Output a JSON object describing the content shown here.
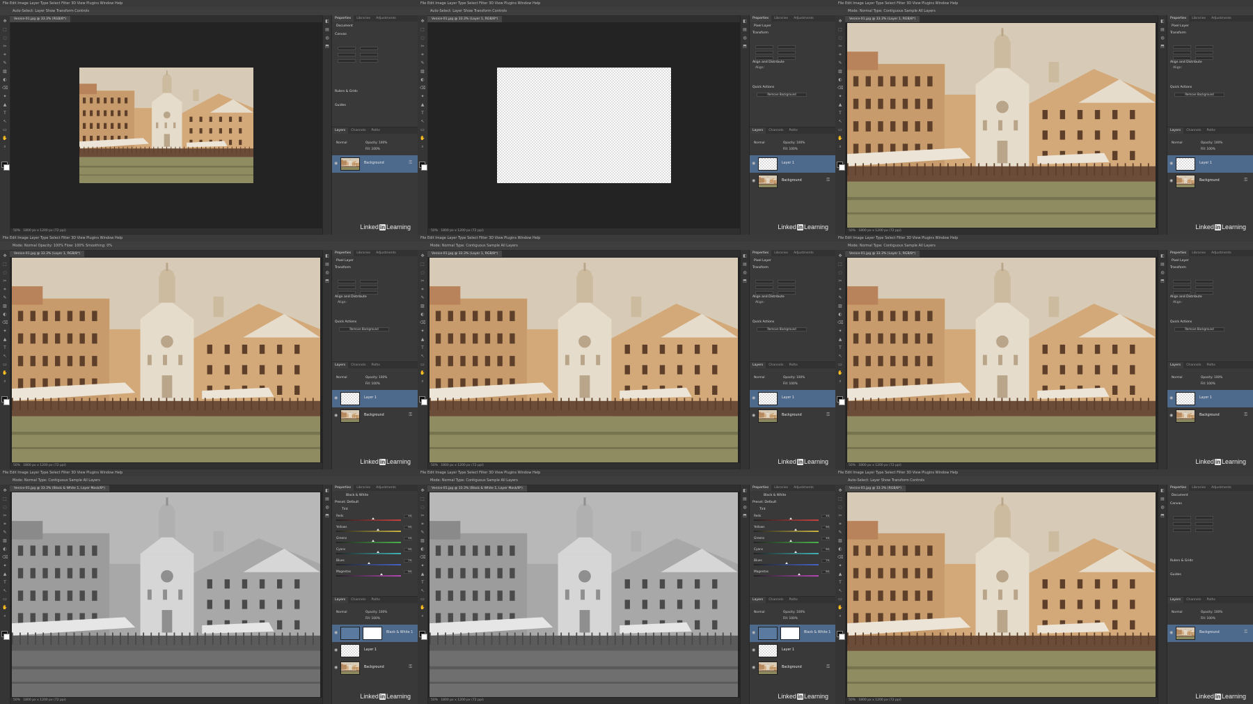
{
  "menu": "File  Edit  Image  Layer  Type  Select  Filter  3D  View  Plugins  Window  Help",
  "options": {
    "move": "Auto-Select:   Layer     Show Transform Controls",
    "brush": "Mode:  Normal    Opacity: 100%    Flow: 100%    Smoothing: 0%",
    "select": "Mode:  Normal    Type: Contiguous    Sample All Layers"
  },
  "app": {
    "watermark_pre": "Linked",
    "watermark_in": "in",
    "watermark_post": "Learning",
    "status_zoom": "50%",
    "status_size": "1800 px x 1200 px (72 ppi)"
  },
  "tabs": {
    "doc": "Venice-01.jpg @ 33.3% (RGB/8*)",
    "layer1": "Venice-01.jpg @ 33.3% (Layer 1, RGB/8*)",
    "bw": "Venice-01.jpg @ 33.3% (Black & White 1, Layer Mask/8*)"
  },
  "panel_tabs": {
    "properties": "Properties",
    "libraries": "Libraries",
    "adjustments": "Adjustments",
    "layers": "Layers",
    "channels": "Channels",
    "paths": "Paths"
  },
  "props": {
    "document": "Document",
    "pixel_layer": "Pixel Layer",
    "canvas": "Canvas",
    "transform": "Transform",
    "align": "Align and Distribute",
    "align_sub": "Align:",
    "quick": "Quick Actions",
    "remove_bg": "Remove Background",
    "rulers": "Rulers & Grids",
    "guides": "Guides",
    "bw_title": "Black & White",
    "preset": "Preset:  Default",
    "tint": "Tint"
  },
  "bw_sliders": [
    {
      "label": "Reds",
      "value": 40,
      "color": "#c94040",
      "pos": 0.55
    },
    {
      "label": "Yellows",
      "value": 60,
      "color": "#c9b440",
      "pos": 0.62
    },
    {
      "label": "Greens",
      "value": 40,
      "color": "#49b44a",
      "pos": 0.55
    },
    {
      "label": "Cyans",
      "value": 60,
      "color": "#3fb3b6",
      "pos": 0.62
    },
    {
      "label": "Blues",
      "value": 20,
      "color": "#4663c9",
      "pos": 0.48
    },
    {
      "label": "Magentas",
      "value": 80,
      "color": "#b546b3",
      "pos": 0.68
    }
  ],
  "layers": {
    "background": "Background",
    "layer1": "Layer 1",
    "bw": "Black & White 1",
    "blend": "Normal",
    "opacity": "Opacity: 100%",
    "fill": "Fill: 100%"
  },
  "colors": {
    "selected_layer": "#4d6a8c",
    "panel": "#393939",
    "ui_bg": "#2b2b2b"
  },
  "icons": {
    "eye": "eye-icon",
    "lock": "lock-icon"
  }
}
